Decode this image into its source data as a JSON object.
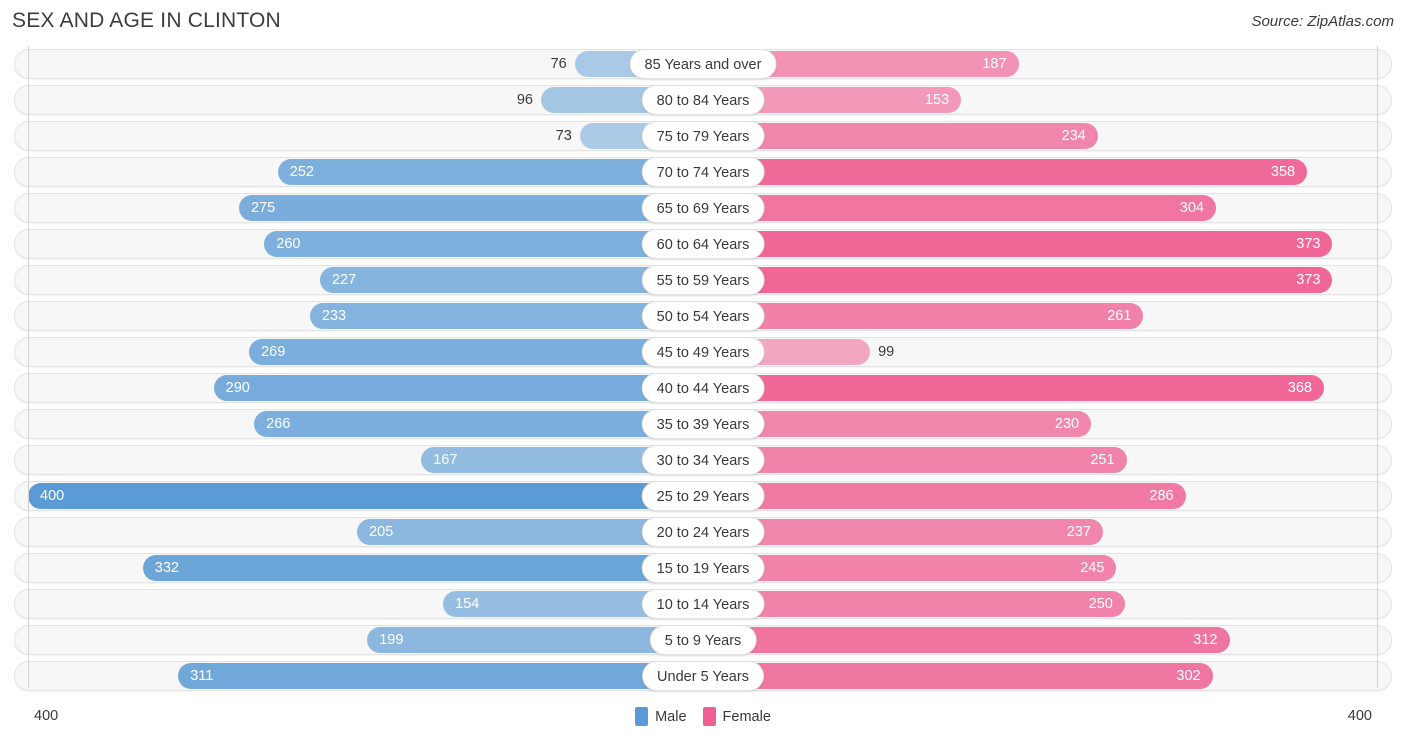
{
  "header": {
    "title": "SEX AND AGE IN CLINTON",
    "source": "Source: ZipAtlas.com"
  },
  "legend": {
    "male_label": "Male",
    "female_label": "Female",
    "male_color": "#5b9bd5",
    "female_color": "#ef5f92"
  },
  "axis": {
    "left_label": "400",
    "right_label": "400",
    "max": 400
  },
  "chart_data": {
    "type": "bar",
    "title": "SEX AND AGE IN CLINTON",
    "subtitle": "",
    "xlabel": "",
    "ylabel": "",
    "orientation": "horizontal-diverging",
    "xlim": [
      0,
      400
    ],
    "grid": false,
    "legend_position": "bottom-center",
    "categories": [
      "85 Years and over",
      "80 to 84 Years",
      "75 to 79 Years",
      "70 to 74 Years",
      "65 to 69 Years",
      "60 to 64 Years",
      "55 to 59 Years",
      "50 to 54 Years",
      "45 to 49 Years",
      "40 to 44 Years",
      "35 to 39 Years",
      "30 to 34 Years",
      "25 to 29 Years",
      "20 to 24 Years",
      "15 to 19 Years",
      "10 to 14 Years",
      "5 to 9 Years",
      "Under 5 Years"
    ],
    "series": [
      {
        "name": "Male",
        "color": "#5b9bd5",
        "values": [
          76,
          96,
          73,
          252,
          275,
          260,
          227,
          233,
          269,
          290,
          266,
          167,
          400,
          205,
          332,
          154,
          199,
          311
        ]
      },
      {
        "name": "Female",
        "color": "#ef5f92",
        "values": [
          187,
          153,
          234,
          358,
          304,
          373,
          373,
          261,
          99,
          368,
          230,
          251,
          286,
          237,
          245,
          250,
          312,
          302
        ]
      }
    ]
  }
}
